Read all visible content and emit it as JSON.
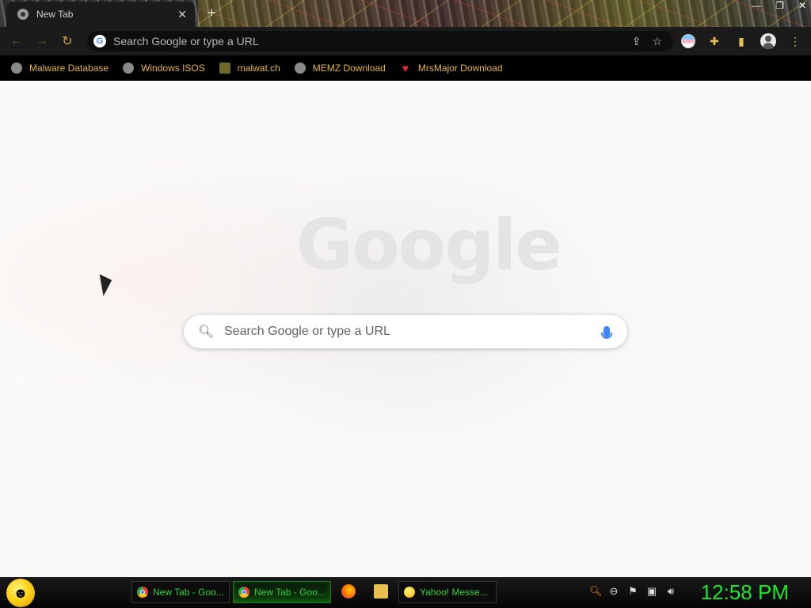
{
  "browser": {
    "tab": {
      "title": "New Tab",
      "close": "✕"
    },
    "new_tab_icon": "+",
    "window_controls": [
      "—",
      "❐",
      "✕"
    ],
    "omnibox": {
      "placeholder": "Search Google or type a URL"
    }
  },
  "bookmarks": [
    {
      "label": "Malware Database",
      "icon": "globe-icon"
    },
    {
      "label": "Windows ISOS",
      "icon": "globe-icon"
    },
    {
      "label": "malwat.ch",
      "icon": "skull-icon"
    },
    {
      "label": "MEMZ Download",
      "icon": "globe-icon"
    },
    {
      "label": "MrsMajor Download",
      "icon": "heart-icon"
    }
  ],
  "newtab": {
    "logo_text": "Google",
    "search_placeholder": "Search Google or type a URL"
  },
  "taskbar": {
    "buttons": [
      {
        "label": "New Tab - Goo..."
      },
      {
        "label": "New Tab - Goo..."
      },
      {
        "label": "Yahoo! Messe..."
      }
    ],
    "clock": "12:58 PM"
  },
  "colors": {
    "bookmark_text": "#e3b44a",
    "taskbar_text": "#34d13a",
    "clock": "#18e82b"
  }
}
